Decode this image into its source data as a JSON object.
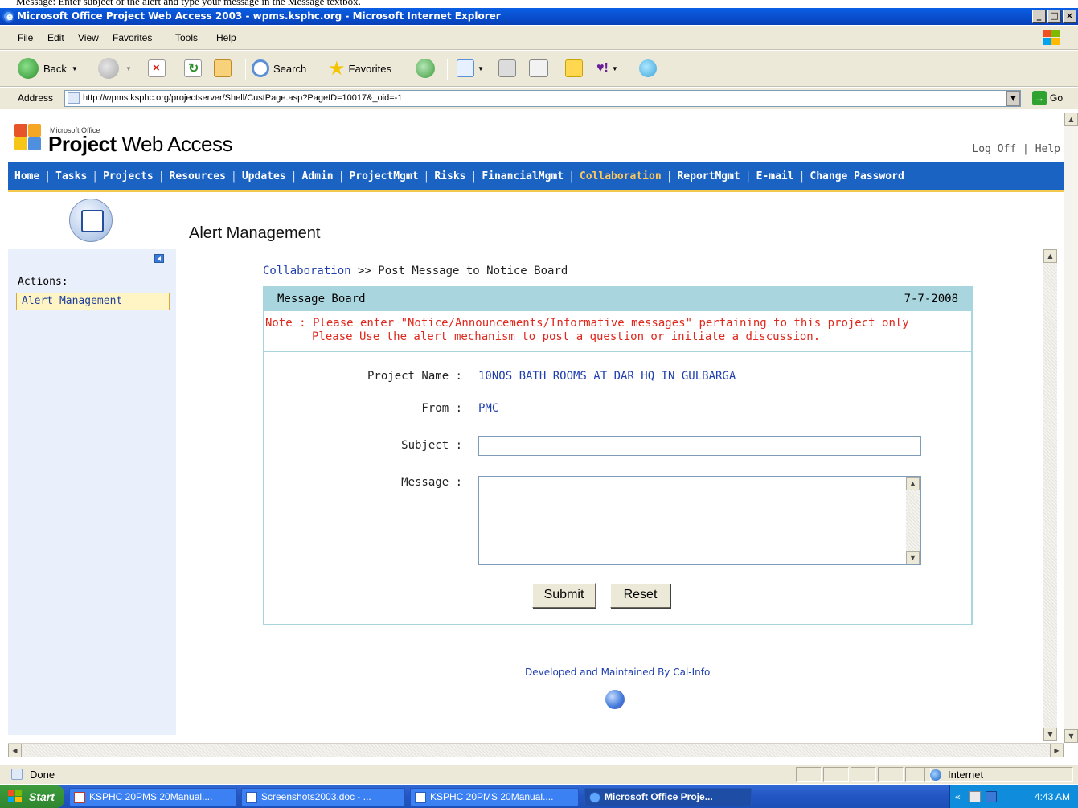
{
  "doc_strip_text": "Message: Enter subject of the alert and type your message in the Message textbox.",
  "window": {
    "title": "Microsoft Office Project Web Access 2003 - wpms.ksphc.org - Microsoft Internet Explorer",
    "min": "_",
    "max": "□",
    "close": "×"
  },
  "menu": [
    "File",
    "Edit",
    "View",
    "Favorites",
    "Tools",
    "Help"
  ],
  "toolbar": {
    "back": "Back",
    "search": "Search",
    "favorites": "Favorites"
  },
  "address": {
    "label": "Address",
    "url": "http://wpms.ksphc.org/projectserver/Shell/CustPage.asp?PageID=10017&_oid=-1",
    "go": "Go"
  },
  "pwa": {
    "logo_small": "Microsoft Office",
    "logo_bold": "Project",
    "logo_rest": " Web Access",
    "log_off": "Log Off",
    "help": "Help",
    "sep": "|"
  },
  "nav": {
    "items": [
      "Home",
      "Tasks",
      "Projects",
      "Resources",
      "Updates",
      "Admin",
      "ProjectMgmt",
      "Risks",
      "FinancialMgmt",
      "Collaboration",
      "ReportMgmt",
      "E-mail",
      "Change Password"
    ],
    "active_index": 9
  },
  "page": {
    "title": "Alert Management"
  },
  "sidebar": {
    "actions_label": "Actions:",
    "items": [
      "Alert Management"
    ]
  },
  "breadcrumb": {
    "link": "Collaboration",
    "rest": " >> Post Message to Notice Board"
  },
  "board": {
    "header": "Message Board",
    "date": "7-7-2008",
    "note_line1": "Note : Please enter \"Notice/Announcements/Informative messages\" pertaining to this project only",
    "note_line2": "Please Use the alert mechanism to post a question or initiate a discussion.",
    "project_label": "Project Name :",
    "project_value": "10NOS BATH ROOMS AT DAR HQ IN GULBARGA",
    "from_label": "From :",
    "from_value": "PMC",
    "subject_label": "Subject :",
    "subject_value": "",
    "message_label": "Message :",
    "message_value": "",
    "submit": "Submit",
    "reset": "Reset"
  },
  "footer": {
    "text": "Developed and Maintained By Cal-Info"
  },
  "status": {
    "text": "Done",
    "zone": "Internet"
  },
  "taskbar": {
    "start": "Start",
    "tasks": [
      "KSPHC 20PMS 20Manual....",
      "Screenshots2003.doc - ...",
      "KSPHC 20PMS 20Manual....",
      "Microsoft Office Proje..."
    ],
    "active_index": 3,
    "time": "4:43 AM"
  },
  "colors": {
    "nav_bg": "#1b63c2",
    "nav_active": "#ffc85c",
    "board_border": "#a9d6de",
    "note_red": "#e0281d",
    "link_blue": "#1f3fae"
  }
}
